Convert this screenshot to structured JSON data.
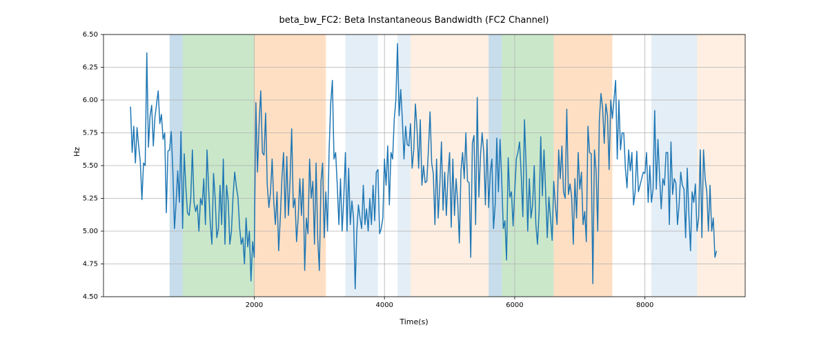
{
  "chart_data": {
    "type": "line",
    "title": "beta_bw_FC2: Beta Instantaneous Bandwidth (FC2 Channel)",
    "xlabel": "Time(s)",
    "ylabel": "Hz",
    "xlim": [
      -315,
      9540
    ],
    "ylim": [
      4.5,
      6.5
    ],
    "xticks": [
      2000,
      4000,
      6000,
      8000
    ],
    "yticks": [
      4.5,
      4.75,
      5.0,
      5.25,
      5.5,
      5.75,
      6.0,
      6.25,
      6.5
    ],
    "grid": true,
    "line_color": "#1f77b4",
    "regions": [
      {
        "x0": 700,
        "x1": 900,
        "color": "#1f77b4",
        "alpha": 0.25
      },
      {
        "x0": 900,
        "x1": 2000,
        "color": "#2ca02c",
        "alpha": 0.25
      },
      {
        "x0": 2000,
        "x1": 3100,
        "color": "#ff7f0e",
        "alpha": 0.25
      },
      {
        "x0": 3400,
        "x1": 3900,
        "color": "#1f77b4",
        "alpha": 0.12
      },
      {
        "x0": 4200,
        "x1": 4400,
        "color": "#1f77b4",
        "alpha": 0.12
      },
      {
        "x0": 4400,
        "x1": 5600,
        "color": "#ff7f0e",
        "alpha": 0.12
      },
      {
        "x0": 5600,
        "x1": 5800,
        "color": "#1f77b4",
        "alpha": 0.25
      },
      {
        "x0": 5800,
        "x1": 6600,
        "color": "#2ca02c",
        "alpha": 0.25
      },
      {
        "x0": 6600,
        "x1": 7500,
        "color": "#ff7f0e",
        "alpha": 0.25
      },
      {
        "x0": 8100,
        "x1": 8800,
        "color": "#1f77b4",
        "alpha": 0.12
      },
      {
        "x0": 8800,
        "x1": 9540,
        "color": "#ff7f0e",
        "alpha": 0.12
      }
    ],
    "series": [
      {
        "name": "beta_bw_FC2",
        "x_start": 100,
        "x_step": 25,
        "values": [
          5.95,
          5.6,
          5.8,
          5.52,
          5.79,
          5.65,
          5.53,
          5.24,
          5.52,
          5.5,
          6.36,
          5.64,
          5.88,
          5.96,
          5.65,
          5.87,
          5.97,
          6.07,
          5.82,
          5.89,
          5.7,
          5.75,
          5.14,
          5.61,
          5.62,
          5.76,
          5.46,
          5.02,
          5.22,
          5.46,
          5.22,
          5.76,
          5.02,
          5.59,
          5.33,
          5.14,
          5.12,
          5.25,
          5.62,
          5.22,
          5.15,
          5.2,
          5.0,
          5.25,
          5.2,
          5.4,
          5.05,
          5.62,
          5.32,
          5.06,
          4.9,
          5.44,
          5.25,
          4.95,
          5.02,
          5.35,
          5.05,
          5.55,
          4.9,
          5.35,
          5.23,
          4.9,
          5.0,
          5.27,
          5.45,
          5.34,
          5.26,
          5.03,
          4.9,
          4.95,
          4.75,
          5.1,
          4.88,
          5.0,
          4.62,
          4.92,
          4.8,
          5.98,
          5.45,
          5.82,
          6.07,
          5.6,
          5.58,
          5.9,
          5.35,
          5.18,
          5.3,
          5.55,
          5.22,
          5.05,
          5.3,
          4.85,
          5.1,
          5.4,
          5.6,
          5.1,
          5.57,
          5.12,
          5.38,
          5.78,
          5.18,
          5.25,
          4.92,
          5.1,
          5.4,
          5.12,
          5.4,
          4.7,
          5.1,
          4.98,
          5.55,
          5.25,
          5.38,
          4.9,
          5.52,
          4.94,
          4.7,
          5.38,
          5.52,
          4.95,
          5.3,
          5.0,
          5.62,
          5.98,
          6.15,
          5.55,
          5.6,
          5.35,
          5.05,
          5.4,
          5.0,
          5.25,
          5.6,
          5.0,
          5.48,
          5.05,
          5.23,
          5.1,
          4.56,
          5.0,
          5.2,
          5.1,
          5.02,
          5.35,
          5.05,
          5.17,
          5.0,
          5.25,
          5.05,
          5.35,
          5.08,
          5.45,
          5.47,
          4.98,
          5.02,
          5.1,
          5.55,
          5.35,
          5.65,
          5.2,
          5.6,
          5.55,
          5.85,
          6.0,
          6.43,
          5.88,
          6.08,
          5.85,
          5.55,
          5.8,
          5.66,
          5.65,
          5.82,
          5.48,
          5.62,
          5.97,
          5.78,
          5.48,
          5.85,
          5.35,
          5.5,
          5.37,
          5.38,
          5.62,
          5.91,
          5.52,
          5.44,
          5.05,
          5.55,
          5.1,
          5.35,
          5.68,
          5.16,
          5.45,
          5.12,
          5.42,
          5.6,
          5.03,
          5.55,
          5.12,
          5.4,
          5.22,
          4.91,
          5.46,
          5.6,
          5.4,
          5.75,
          5.38,
          5.37,
          4.8,
          5.67,
          5.73,
          5.05,
          6.02,
          5.26,
          5.58,
          5.75,
          5.6,
          5.2,
          5.7,
          5.18,
          5.45,
          5.55,
          5.02,
          5.2,
          5.71,
          5.3,
          5.7,
          5.4,
          5.02,
          5.08,
          4.78,
          5.56,
          5.26,
          5.3,
          5.04,
          5.3,
          5.55,
          5.6,
          5.68,
          5.43,
          5.11,
          5.85,
          5.5,
          5.0,
          5.4,
          5.1,
          5.2,
          5.5,
          5.05,
          4.9,
          5.15,
          5.72,
          5.27,
          5.62,
          5.3,
          4.95,
          5.26,
          5.1,
          4.93,
          5.38,
          5.2,
          5.05,
          5.62,
          5.4,
          5.65,
          5.3,
          5.25,
          5.93,
          5.28,
          5.36,
          5.26,
          4.9,
          5.4,
          5.1,
          5.6,
          5.32,
          5.45,
          5.05,
          5.15,
          4.92,
          5.8,
          5.6,
          5.59,
          4.6,
          5.62,
          5.46,
          5.0,
          5.85,
          6.05,
          5.94,
          5.67,
          5.97,
          5.88,
          5.47,
          6.0,
          5.86,
          6.0,
          6.15,
          5.55,
          6.0,
          5.62,
          5.75,
          5.75,
          5.48,
          5.33,
          5.62,
          5.46,
          5.6,
          5.2,
          5.3,
          5.61,
          5.3,
          5.35,
          5.4,
          5.45,
          5.44,
          5.6,
          5.22,
          5.5,
          5.22,
          5.32,
          5.92,
          5.32,
          5.7,
          5.42,
          5.17,
          5.4,
          5.35,
          5.6,
          5.6,
          5.05,
          5.68,
          5.28,
          5.4,
          5.37,
          5.05,
          5.2,
          5.45,
          5.35,
          5.32,
          4.95,
          5.48,
          5.13,
          4.85,
          5.3,
          5.22,
          5.36,
          5.0,
          5.1,
          5.62,
          4.95,
          5.62,
          5.4,
          5.3,
          5.0,
          5.35,
          5.0,
          5.1,
          4.8,
          4.85
        ]
      }
    ]
  }
}
